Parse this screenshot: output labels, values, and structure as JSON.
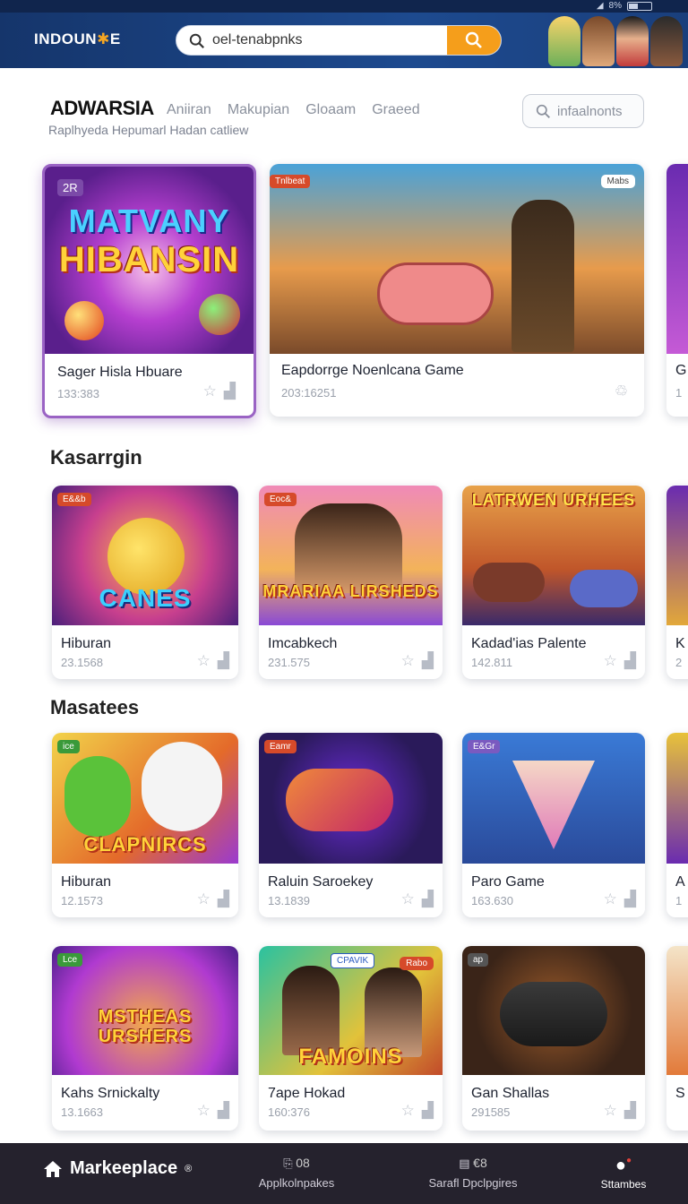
{
  "status_bar": {
    "battery": "8%"
  },
  "header": {
    "logo": "INDOUN",
    "logo_suffix": "E",
    "search_value": "oel-tenabpnks"
  },
  "store": {
    "brand": "ADWARSIA",
    "subtitle": "Raplhyeda Hepumarl Hadan catliew",
    "tabs": [
      "Aniiran",
      "Makupian",
      "Gloaam",
      "Graeed"
    ],
    "search_placeholder": "infaalnonts"
  },
  "featured": [
    {
      "badge": "2R",
      "art_text_1": "MATVANY",
      "art_text_2": "HIBANSIN",
      "title": "Sager Hisla Hbuare",
      "count": "133:383"
    },
    {
      "badge": "Tnlbeat",
      "badge_right": "Mabs",
      "title": "Eapdorrge Noenlcana Game",
      "count": "203:16251"
    },
    {
      "title": "G",
      "count": "1"
    }
  ],
  "sections": [
    {
      "title": "Kasarrgin",
      "cards": [
        {
          "badge": "E&&b",
          "art_text": "CANES",
          "title": "Hiburan",
          "count": "23.1568"
        },
        {
          "badge": "Eoc&",
          "art_text": "MRARIAA LIRSHEDS",
          "title": "Imcabkech",
          "count": "231.575"
        },
        {
          "art_text": "LATRWEN URHEES",
          "title": "Kadad'ias Palente",
          "count": "142.811"
        },
        {
          "title": "K",
          "count": "2"
        }
      ]
    },
    {
      "title": "Masatees",
      "cards": [
        {
          "badge": "ice",
          "art_text": "CLAPNIRCS",
          "title": "Hiburan",
          "count": "12.1573"
        },
        {
          "badge": "Eamr",
          "title": "Raluin Saroekey",
          "count": "13.1839"
        },
        {
          "badge": "E&Gr",
          "title": "Paro Game",
          "count": "163.630"
        },
        {
          "title": "A",
          "count": "1"
        }
      ]
    },
    {
      "title": "",
      "cards": [
        {
          "badge": "Lce",
          "art_text": "MSTHEAS URSHERS",
          "title": "Kahs Srnickalty",
          "count": "13.1663"
        },
        {
          "badge": "CPAVIK",
          "badge_right": "Rabo",
          "art_text": "FAMOINS",
          "title": "7ape Hokad",
          "count": "160:376"
        },
        {
          "badge": "ap",
          "title": "Gan Shallas",
          "count": "291585"
        },
        {
          "title": "S",
          "count": ""
        }
      ]
    }
  ],
  "bottom_nav": {
    "home": "Markeeplace",
    "home_sup": "®",
    "apps_label": "Applkolnpakes",
    "apps_count": "08",
    "dev_label": "Sarafl Dpclpgires",
    "dev_count": "€8",
    "stat_label": "Sttambes"
  }
}
